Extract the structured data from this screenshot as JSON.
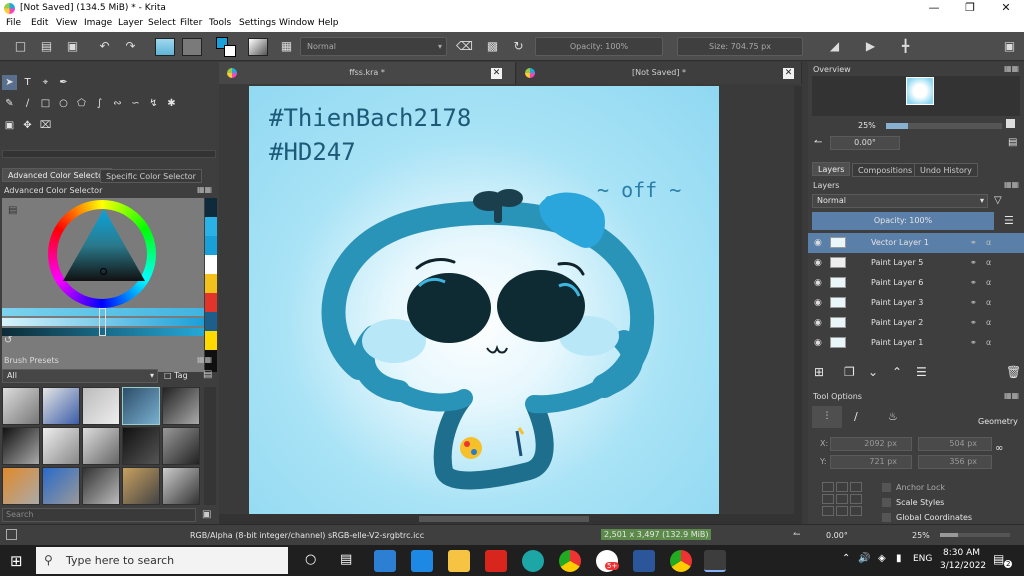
{
  "window": {
    "title": "[Not Saved]  (134.5 MiB)  * - Krita"
  },
  "menu": [
    "File",
    "Edit",
    "View",
    "Image",
    "Layer",
    "Select",
    "Filter",
    "Tools",
    "Settings",
    "Window",
    "Help"
  ],
  "toolbar": {
    "blend_mode": "Normal",
    "opacity": "Opacity: 100%",
    "size": "Size: 704.75 px"
  },
  "left": {
    "color_tabs": [
      "Advanced Color Selector",
      "Specific Color Selector"
    ],
    "color_dock_title": "Advanced Color Selector",
    "brush_title": "Brush Presets",
    "brush_filter": "All",
    "brush_tag": "Tag",
    "search_placeholder": "Search",
    "swatches": [
      "#0d2b3a",
      "#2ab2e6",
      "#1aa0d8",
      "#ffffff",
      "#f2c11c",
      "#e3342c",
      "#1c5f8a",
      "#ffd900",
      "#0f0f0f"
    ]
  },
  "canvas": {
    "tabs": [
      {
        "label": "ffss.kra *"
      },
      {
        "label": "[Not Saved] *"
      }
    ],
    "text1": "#ThienBach2178",
    "text2": "#HD247",
    "text3": "~ off ~"
  },
  "right": {
    "overview_title": "Overview",
    "zoom": "25%",
    "rotation": "0.00°",
    "tabs": [
      "Layers",
      "Compositions",
      "Undo History"
    ],
    "layers_title": "Layers",
    "blend": "Normal",
    "opacity": "Opacity:  100%",
    "layers": [
      {
        "name": "Vector Layer 1"
      },
      {
        "name": "Paint Layer 5"
      },
      {
        "name": "Paint Layer 6"
      },
      {
        "name": "Paint Layer 3"
      },
      {
        "name": "Paint Layer 2"
      },
      {
        "name": "Paint Layer 1"
      }
    ],
    "tool_options_title": "Tool Options",
    "geometry": "Geometry",
    "x_label": "X:",
    "y_label": "Y:",
    "x_value": "2092 px",
    "y_value": "721 px",
    "w_value": "504 px",
    "h_value": "356 px",
    "anchor_lock": "Anchor Lock",
    "scale_styles": "Scale Styles",
    "global_coords": "Global Coordinates"
  },
  "status": {
    "color_space": "RGB/Alpha (8-bit integer/channel)  sRGB-elle-V2-srgbtrc.icc",
    "image_size": "2,501 x 3,497 (132.9 MiB)",
    "rotation": "0.00°",
    "zoom": "25%"
  },
  "taskbar": {
    "search_placeholder": "Type here to search",
    "time": "8:30 AM",
    "date": "3/12/2022",
    "lang": "ENG",
    "badge": "5+",
    "notif_count": "2"
  }
}
